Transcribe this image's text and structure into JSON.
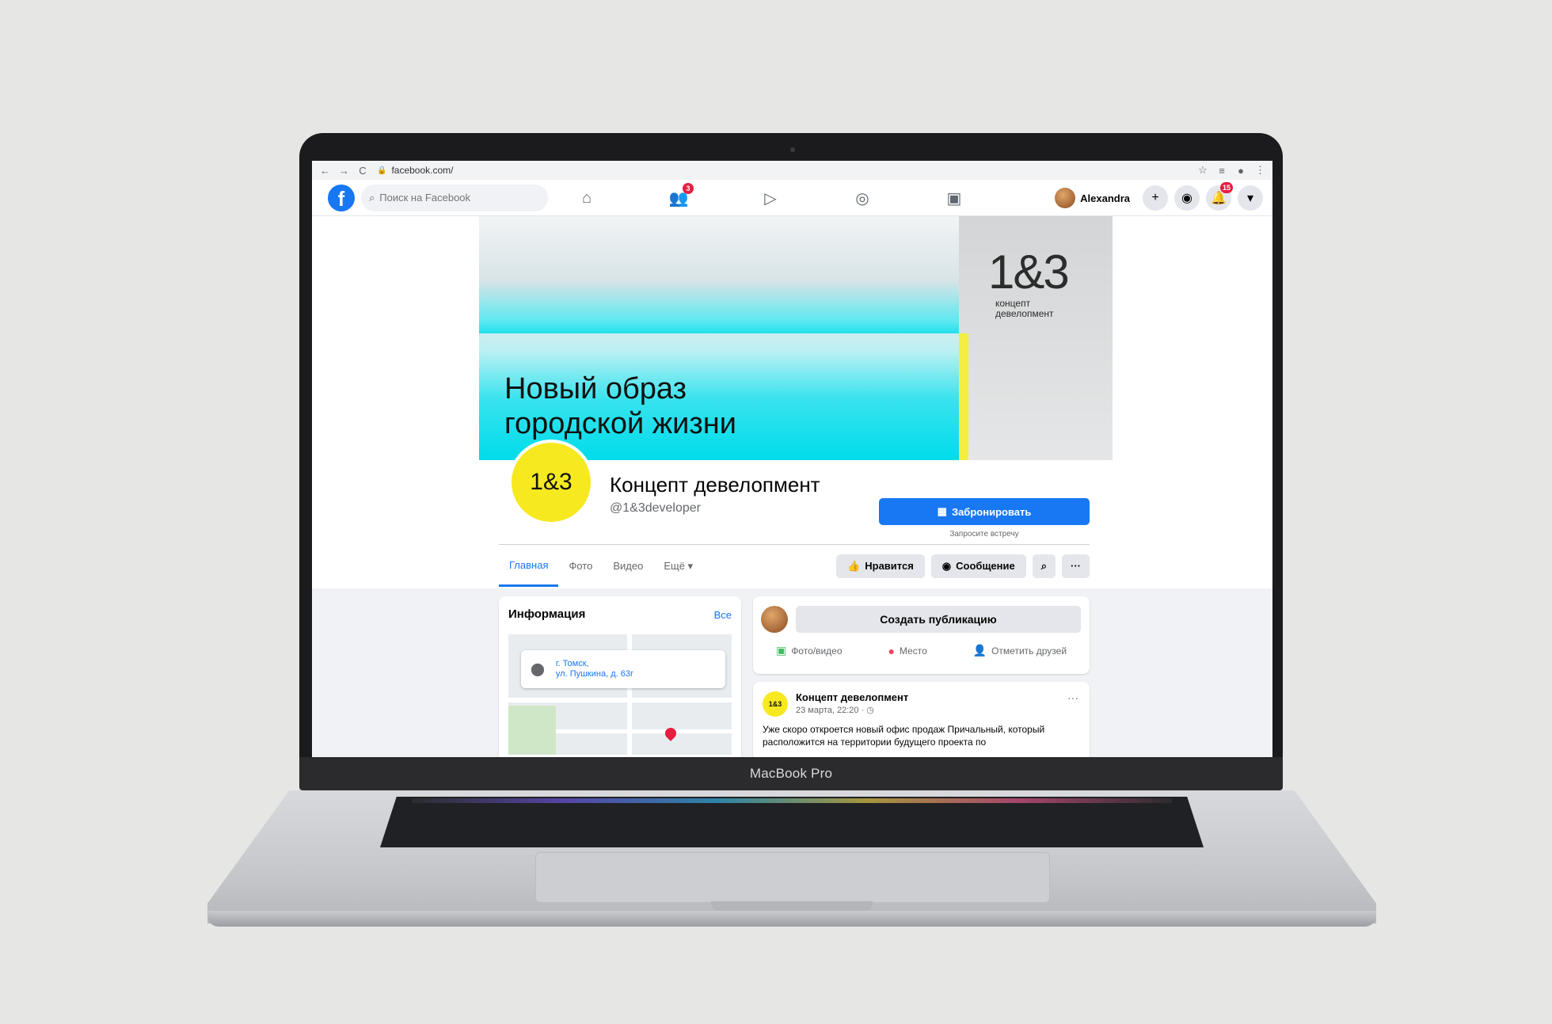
{
  "browser": {
    "url": "facebook.com/",
    "back_glyph": "←",
    "forward_glyph": "→",
    "reload_glyph": "C",
    "star_glyph": "☆",
    "menu_glyph": "⋮"
  },
  "topbar": {
    "logo": "f",
    "search_placeholder": "Поиск на Facebook",
    "friends_badge": "3",
    "profile_name": "Alexandra",
    "notifications_badge": "15"
  },
  "cover": {
    "logo": "1&3",
    "logo_sub_line1": "концепт",
    "logo_sub_line2": "девелопмент",
    "headline_line1": "Новый образ",
    "headline_line2": "городской жизни"
  },
  "page": {
    "avatar_text": "1&3",
    "name": "Концепт девелопмент",
    "handle": "@1&3developer",
    "book_button": "Забронировать",
    "book_subtext": "Запросите встречу"
  },
  "tabs": [
    {
      "label": "Главная"
    },
    {
      "label": "Фото"
    },
    {
      "label": "Видео"
    },
    {
      "label": "Ещё ▾"
    }
  ],
  "actions": {
    "like": "Нравится",
    "message": "Сообщение",
    "more": "···"
  },
  "info": {
    "title": "Информация",
    "all_link": "Все",
    "address_line1": "г. Томск,",
    "address_line2": "ул. Пушкина, д. 63г"
  },
  "composer": {
    "create_post": "Создать публикацию",
    "photo_video": "Фото/видео",
    "place": "Место",
    "tag_friends": "Отметить друзей"
  },
  "post": {
    "avatar_text": "1&3",
    "author": "Концепт девелопмент",
    "meta": "23 марта, 22:20 · ◷",
    "more": "···",
    "text": "Уже скоро откроется новый офис продаж Причальный, который расположится на территории будущего проекта по"
  },
  "device": {
    "chin_label": "MacBook Pro"
  }
}
